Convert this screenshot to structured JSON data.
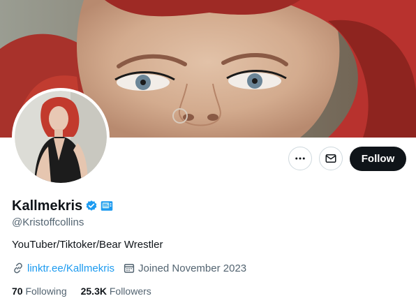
{
  "profile": {
    "display_name": "Kallmekris",
    "handle": "@Kristoffcollins",
    "bio": "YouTuber/Tiktoker/Bear Wrestler",
    "verified_badge_icon": "verified-check-icon",
    "affiliate_badge_icon": "tv-emoji-icon",
    "link": "linktr.ee/Kallmekris",
    "joined": "Joined November 2023"
  },
  "stats": {
    "following_count": "70",
    "following_label": "Following",
    "followers_count": "25.3K",
    "followers_label": "Followers"
  },
  "actions": {
    "more_icon": "more-horizontal-icon",
    "message_icon": "envelope-icon",
    "follow_label": "Follow"
  },
  "colors": {
    "accent": "#1d9bf0",
    "follow_bg": "#0f1419",
    "secondary_text": "#536471",
    "hair": "#b8322e"
  }
}
